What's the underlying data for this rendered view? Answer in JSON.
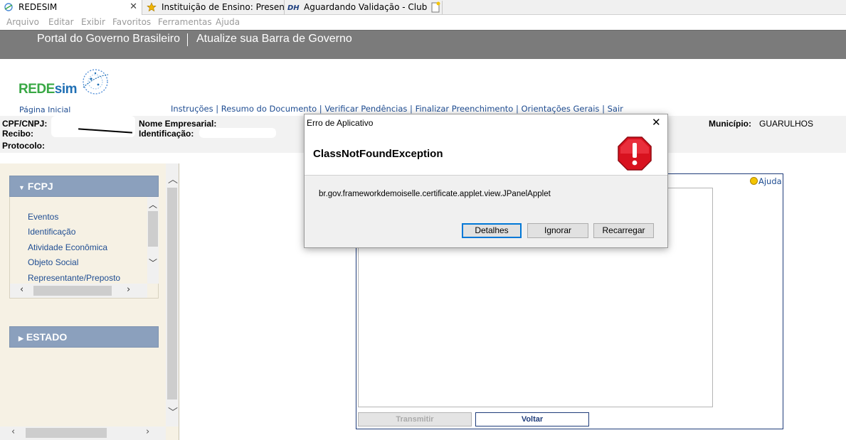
{
  "browser": {
    "tabs": [
      {
        "label": "REDESIM",
        "close": "✕"
      },
      {
        "label": "Instituição de Ensino: Presenci..."
      },
      {
        "label": "Aguardando Validação - Clube..."
      }
    ],
    "menu": [
      "Arquivo",
      "Editar",
      "Exibir",
      "Favoritos",
      "Ferramentas",
      "Ajuda"
    ]
  },
  "govbar": {
    "portal": "Portal do Governo Brasileiro",
    "update": "Atualize sua Barra de Governo"
  },
  "header": {
    "logo_a": "REDE",
    "logo_b": "sim",
    "home": "Página Inicial",
    "nav": "Instruções | Resumo do Documento | Verificar Pendências | Finalizar Preenchimento | Orientações Gerais | Sair"
  },
  "info": {
    "cpf_label": "CPF/CNPJ:",
    "recibo_label": "Recibo:",
    "protocolo_label": "Protocolo:",
    "nome_label": "Nome Empresarial:",
    "ident_label": "Identificação:",
    "municipio_label": "Município:",
    "municipio_value": "GUARULHOS"
  },
  "sidebar": {
    "fcpj": "FCPJ",
    "items": [
      "Eventos",
      "Identificação",
      "Atividade Econômica",
      "Objeto Social",
      "Representante/Preposto"
    ],
    "estado": "ESTADO"
  },
  "content": {
    "ajuda": "Ajuda",
    "transmitir": "Transmitir",
    "voltar": "Voltar"
  },
  "dialog": {
    "title": "Erro de Aplicativo",
    "exception": "ClassNotFoundException",
    "message": "br.gov.frameworkdemoiselle.certificate.applet.view.JPanelApplet",
    "buttons": {
      "details": "Detalhes",
      "ignore": "Ignorar",
      "reload": "Recarregar"
    },
    "close": "✕"
  },
  "colors": {
    "accent": "#1f4d92",
    "panel_header": "#8ba0bd",
    "gov_bar": "#7b7b7b",
    "error_red": "#d8121f"
  }
}
